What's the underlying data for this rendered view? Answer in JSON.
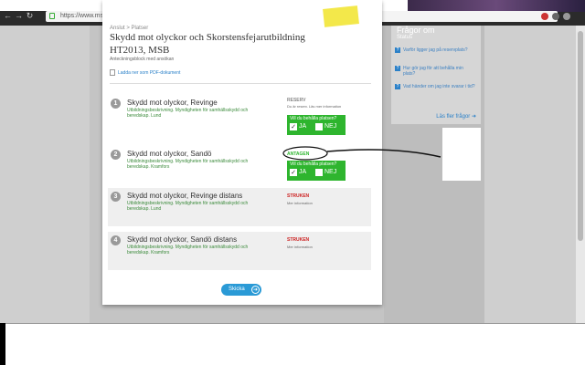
{
  "browser": {
    "url": "https://www.msb.se/mypage/applications",
    "nav_back": "←",
    "nav_forward": "→",
    "nav_reload": "↻"
  },
  "page": {
    "breadcrumb": "Anslut > Platser",
    "title": "Skydd mot olyckor och Skorstensfejarutbildning HT2013, MSB",
    "subtitle": "Anteckningsblock med ansökan",
    "pdf_link": "Ladda ner som PDF-dokument",
    "submit_label": "Skicka",
    "rows": [
      {
        "num": "1",
        "title": "Skydd mot olyckor, Revinge",
        "desc": "Utbildningsbeskrivning. Myndigheten för samhällsskydd och beredskap. Lund",
        "status": "RESERV",
        "status_color": "#888888",
        "info": "Du är reserv. Läs mer information",
        "question": "Vill du behålla platsen?",
        "yes": "JA",
        "no": "NEJ",
        "checked_yes": "✓",
        "checked_no": ""
      },
      {
        "num": "2",
        "title": "Skydd mot olyckor, Sandö",
        "desc": "Utbildningsbeskrivning. Myndigheten för samhällsskydd och beredskap. Kramfors",
        "status": "ANTAGEN",
        "status_color": "#2eb52e",
        "info": "",
        "question": "Vill du behålla platsen?",
        "yes": "JA",
        "no": "NEJ",
        "checked_yes": "✓",
        "checked_no": ""
      },
      {
        "num": "3",
        "title": "Skydd mot olyckor, Revinge distans",
        "desc": "Utbildningsbeskrivning. Myndigheten för samhällsskydd och beredskap. Lund",
        "status": "STRUKEN",
        "status_color": "#cc2222",
        "info": "Mer information"
      },
      {
        "num": "4",
        "title": "Skydd mot olyckor, Sandö distans",
        "desc": "Utbildningsbeskrivning. Myndigheten för samhällsskydd och beredskap. Kramfors",
        "status": "STRUKEN",
        "status_color": "#cc2222",
        "info": "Mer information"
      }
    ]
  },
  "faq": {
    "title": "Frågor om",
    "sub": "Status",
    "items": [
      "Varför ligger jag på reservplats?",
      "Hur gör jag för att behålla min plats?",
      "Vad händer om jag inte svarar i tid?"
    ],
    "more": "Läs fler frågor ➜"
  },
  "colors": {
    "accent": "#2a9ad6",
    "green": "#2eb52e",
    "red": "#cc2222"
  }
}
